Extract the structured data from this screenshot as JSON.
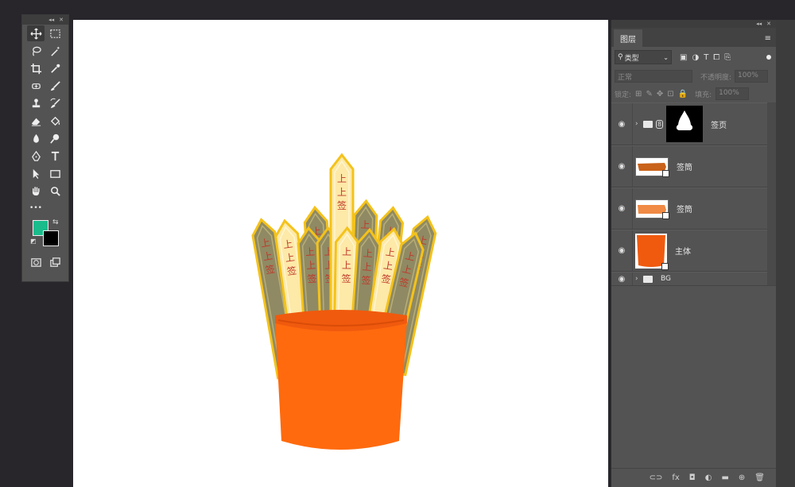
{
  "toolbox": {
    "collapse_glyph": "◂◂",
    "close_glyph": "✕",
    "foreground_color": "#1abc8c",
    "background_color": "#000000",
    "more_glyph": "•••",
    "tools": [
      [
        "move-tool-icon",
        "marquee-tool-icon"
      ],
      [
        "lasso-tool-icon",
        "magic-wand-tool-icon"
      ],
      [
        "crop-tool-icon",
        "eyedropper-tool-icon"
      ],
      [
        "healing-brush-tool-icon",
        "brush-tool-icon"
      ],
      [
        "clone-stamp-tool-icon",
        "history-brush-tool-icon"
      ],
      [
        "eraser-tool-icon",
        "paint-bucket-tool-icon"
      ],
      [
        "blur-tool-icon",
        "dodge-tool-icon"
      ],
      [
        "pen-tool-icon",
        "type-tool-icon"
      ],
      [
        "path-selection-tool-icon",
        "rectangle-tool-icon"
      ],
      [
        "hand-tool-icon",
        "zoom-tool-icon"
      ]
    ]
  },
  "layers_panel": {
    "tab_label": "图层",
    "menu_glyph": "≡",
    "filter": {
      "label": "类型",
      "search_glyph": "⚲",
      "chevron": "⌄"
    },
    "blend_mode": "正常",
    "opacity_label": "不透明度:",
    "opacity_value": "100%",
    "lock_label": "锁定:",
    "fill_label": "填充:",
    "fill_value": "100%",
    "eye_glyph": "◉",
    "expand_glyph": "›",
    "link_glyph": "8",
    "layers": [
      {
        "name": "签页",
        "kind": "group-with-mask",
        "thumb_color": "#000000"
      },
      {
        "name": "签筒",
        "kind": "smart-object",
        "thumb_color": "#c9621a"
      },
      {
        "name": "签筒",
        "kind": "smart-object",
        "thumb_color": "#f08a44"
      },
      {
        "name": "主体",
        "kind": "smart-object",
        "thumb_color": "#f05a0e"
      },
      {
        "name": "BG",
        "kind": "group"
      }
    ],
    "bottom_icons": [
      "link-layers-icon",
      "fx-icon",
      "add-mask-icon",
      "adjustment-layer-icon",
      "new-group-icon",
      "new-layer-icon",
      "delete-layer-icon"
    ],
    "bottom_glyphs": [
      "⊂⊃",
      "fx",
      "◘",
      "◐",
      "▬",
      "⊕",
      "🗑"
    ]
  },
  "canvas": {
    "background": "#ffffff",
    "stick_text": [
      "上",
      "上",
      "签"
    ],
    "cup_color": "#ff6a0e",
    "cup_rim_color": "#f05a0e",
    "stick_dark_color": "#8f8a63",
    "stick_light_color": "#fde9a8",
    "stick_border_color": "#f4c21a"
  }
}
